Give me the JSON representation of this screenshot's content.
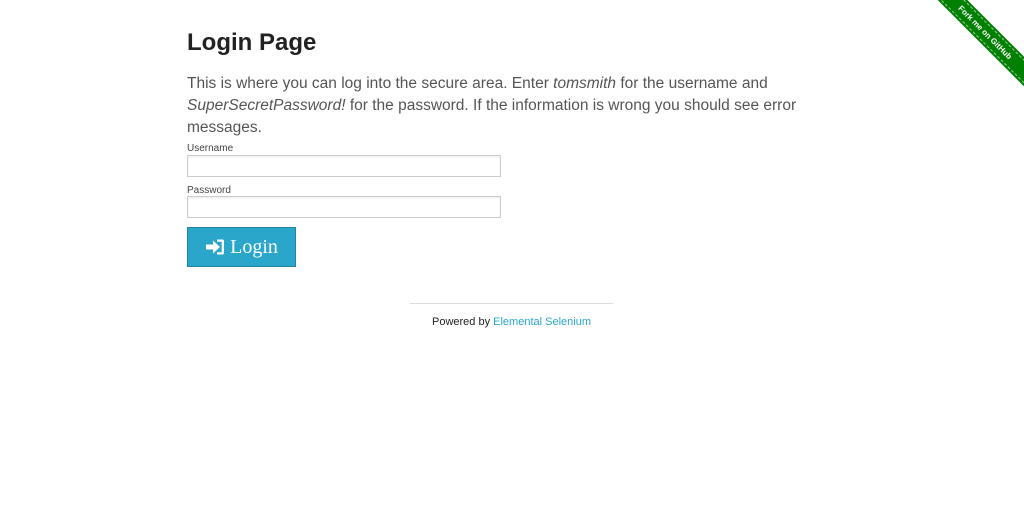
{
  "page": {
    "title": "Login Page",
    "intro": {
      "part1": "This is where you can log into the secure area. Enter ",
      "username_hint": "tomsmith",
      "part2": " for the username and ",
      "password_hint": "SuperSecretPassword!",
      "part3": " for the password. If the information is wrong you should see error messages."
    }
  },
  "form": {
    "username_label": "Username",
    "username_value": "",
    "password_label": "Password",
    "password_value": "",
    "login_label": "Login",
    "login_icon": "sign-in-icon"
  },
  "footer": {
    "prefix": "Powered by ",
    "link_text": "Elemental Selenium"
  },
  "ribbon": {
    "text": "Fork me on GitHub"
  },
  "colors": {
    "button": "#2ba6cb",
    "link": "#2ba6cb",
    "ribbon": "#008000"
  }
}
